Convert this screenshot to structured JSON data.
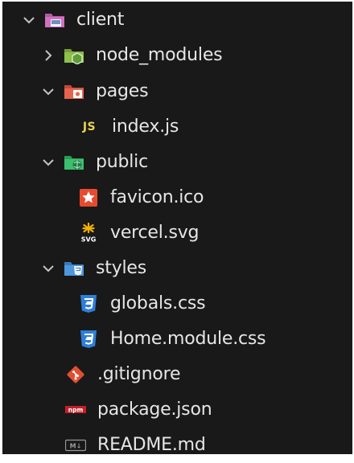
{
  "explorer": {
    "items": [
      {
        "label": "client",
        "icon": "folder-client-icon",
        "expanded": true
      },
      {
        "label": "node_modules",
        "icon": "folder-node-icon",
        "expanded": false
      },
      {
        "label": "pages",
        "icon": "folder-pages-icon",
        "expanded": true
      },
      {
        "label": "index.js",
        "icon": "javascript-icon",
        "icon_text": "JS"
      },
      {
        "label": "public",
        "icon": "folder-public-icon",
        "expanded": true
      },
      {
        "label": "favicon.ico",
        "icon": "favicon-icon"
      },
      {
        "label": "vercel.svg",
        "icon": "svg-file-icon",
        "icon_text": "SVG"
      },
      {
        "label": "styles",
        "icon": "folder-styles-icon",
        "expanded": true
      },
      {
        "label": "globals.css",
        "icon": "css-icon"
      },
      {
        "label": "Home.module.css",
        "icon": "css-icon"
      },
      {
        "label": ".gitignore",
        "icon": "git-icon"
      },
      {
        "label": "package.json",
        "icon": "npm-icon",
        "icon_text": "npm"
      },
      {
        "label": "README.md",
        "icon": "markdown-icon",
        "icon_text": "M↓"
      }
    ]
  },
  "colors": {
    "background": "#191919",
    "text": "#e6e6e6",
    "chevron": "#c5c5c5",
    "js": "#e8d44d",
    "css": "#2f7fd6",
    "git": "#e14f32",
    "npm": "#c12127",
    "favicon": "#e84a2f",
    "svg": "#f5b100"
  }
}
